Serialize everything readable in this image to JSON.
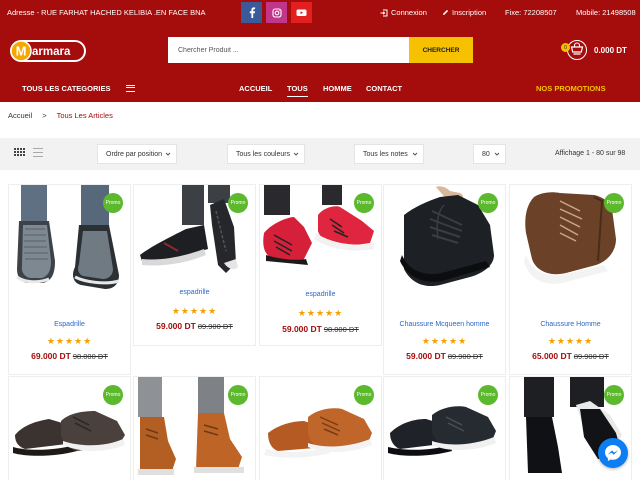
{
  "topbar": {
    "address": "Adresse - RUE FARHAT HACHED KELIBIA .EN FACE BNA",
    "social": [
      "facebook-icon",
      "instagram-icon",
      "youtube-icon"
    ],
    "login": "Connexion",
    "register": "Inscription",
    "fixe": "Fixe: 72208507",
    "mobile": "Mobile: 21498508"
  },
  "header": {
    "logo_text": "Marmara",
    "search_placeholder": "Chercher Produit ...",
    "search_button": "CHERCHER",
    "cart_count": "0",
    "cart_total": "0.000 DT"
  },
  "nav": {
    "categories": "TOUS LES CATEGORIES",
    "items": [
      "ACCUEIL",
      "TOUS",
      "HOMME",
      "CONTACT"
    ],
    "active": "TOUS",
    "promotions": "NOS PROMOTIONS"
  },
  "breadcrumb": {
    "home": "Accueil",
    "separator": ">",
    "current": "Tous Les Articles"
  },
  "toolbar": {
    "sort": "Ordre par position",
    "colors": "Tous les couleurs",
    "ratings": "Tous les notes",
    "per_page": "80",
    "count": "Affichage 1 - 80 sur 98"
  },
  "products": [
    {
      "name": "Espadrille",
      "price": "69.000 DT",
      "old_price": "98.000 DT",
      "badge": "Promo",
      "stars": "★★★★★",
      "style": "mesh"
    },
    {
      "name": "espadrille",
      "price": "59.000 DT",
      "old_price": "89.900 DT",
      "badge": "Promo",
      "stars": "★★★★★",
      "style": "black-sneaker"
    },
    {
      "name": "espadrille",
      "price": "59.000 DT",
      "old_price": "98.000 DT",
      "badge": "Promo",
      "stars": "★★★★★",
      "style": "red-sneaker"
    },
    {
      "name": "Chaussure Mcqueen homme",
      "price": "59.000 DT",
      "old_price": "89.900 DT",
      "badge": "Promo",
      "stars": "★★★★★",
      "style": "black-shoe"
    },
    {
      "name": "Chaussure Homme",
      "price": "65.000 DT",
      "old_price": "89.900 DT",
      "badge": "Promo",
      "stars": "★★★★★",
      "style": "brown-shoe"
    },
    {
      "name": "",
      "price": "",
      "old_price": "",
      "badge": "Promo",
      "stars": "",
      "style": "dark-casual"
    },
    {
      "name": "",
      "price": "",
      "old_price": "",
      "badge": "Promo",
      "stars": "",
      "style": "tan-boot"
    },
    {
      "name": "",
      "price": "",
      "old_price": "",
      "badge": "Promo",
      "stars": "",
      "style": "tan-sneaker"
    },
    {
      "name": "",
      "price": "",
      "old_price": "",
      "badge": "Promo",
      "stars": "",
      "style": "black-loafer"
    },
    {
      "name": "",
      "price": "",
      "old_price": "",
      "badge": "Promo",
      "stars": "",
      "style": "black-derby"
    }
  ],
  "colors": {
    "brand": "#a50c0c",
    "accent": "#f5c100",
    "promo_badge": "#5cb82d",
    "link": "#2a68c6"
  }
}
